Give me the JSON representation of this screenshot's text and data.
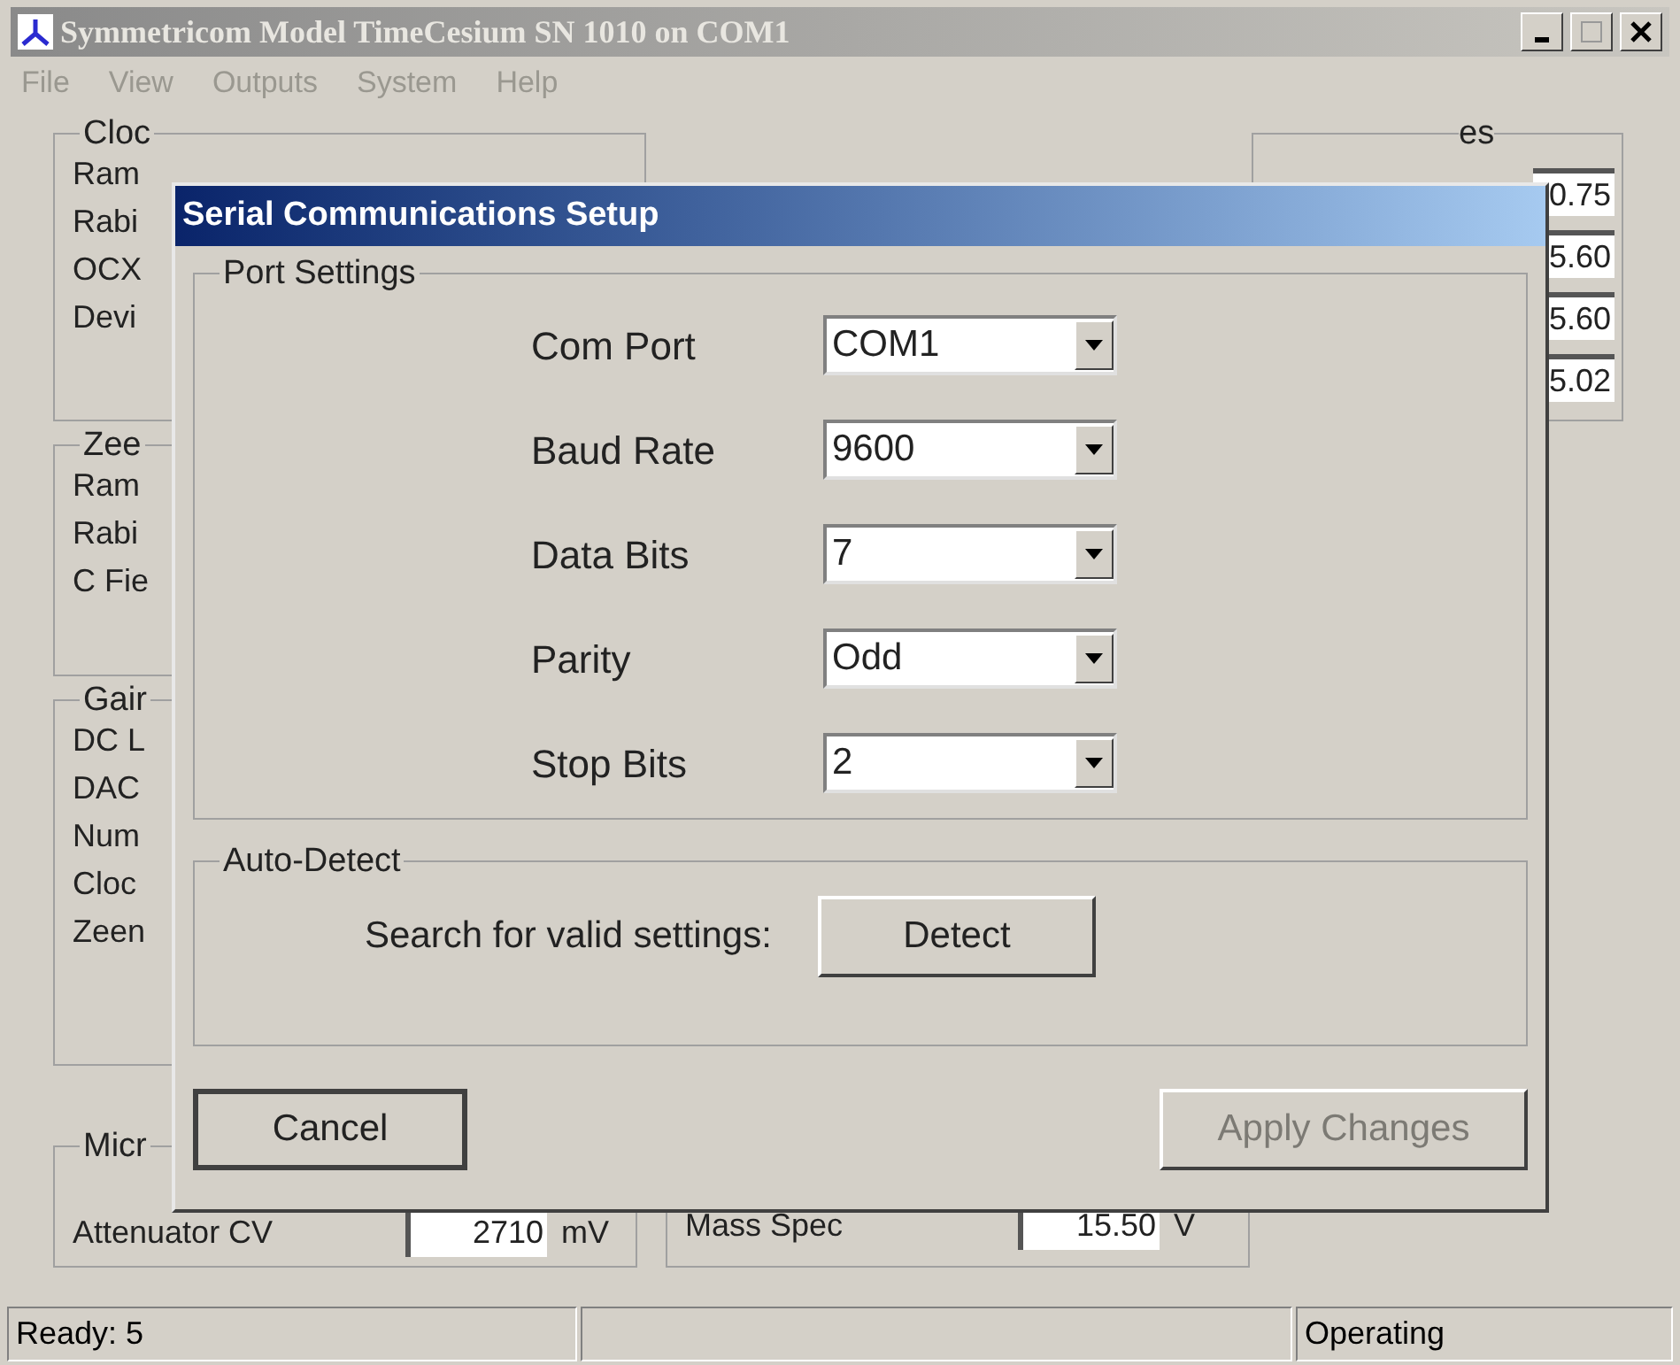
{
  "window": {
    "title": "Symmetricom Model TimeCesium SN 1010 on COM1"
  },
  "menu": [
    {
      "label": "File",
      "disabled": true
    },
    {
      "label": "View",
      "disabled": true
    },
    {
      "label": "Outputs",
      "disabled": true
    },
    {
      "label": "System",
      "disabled": true
    },
    {
      "label": "Help",
      "disabled": true
    }
  ],
  "left_groups": [
    {
      "label": "Cloc",
      "rows": [
        "Ram",
        "Rabi",
        "OCX",
        "Devi"
      ]
    },
    {
      "label": "Zee",
      "rows": [
        "Ram",
        "Rabi",
        "C Fie"
      ]
    },
    {
      "label": "Gair",
      "rows": [
        "DC L",
        "DAC",
        "Num",
        "Cloc",
        "Zeen"
      ]
    }
  ],
  "bottom_groups": [
    {
      "label": "Micr",
      "label_visible": true,
      "rows": [
        {
          "label": "Attenuator CV",
          "value": "2710",
          "unit": "mV"
        }
      ]
    },
    {
      "rows": [
        {
          "label": "Mass Spec",
          "value": "15.50",
          "unit": "V"
        }
      ]
    }
  ],
  "right_group": {
    "label": "es",
    "values": [
      "0.75",
      "5.60",
      "5.60",
      "5.02"
    ]
  },
  "dialog": {
    "title": "Serial Communications Setup",
    "port_settings": {
      "label": "Port Settings",
      "fields": [
        {
          "label": "Com Port",
          "value": "COM1"
        },
        {
          "label": "Baud Rate",
          "value": "9600"
        },
        {
          "label": "Data Bits",
          "value": "7"
        },
        {
          "label": "Parity",
          "value": "Odd"
        },
        {
          "label": "Stop Bits",
          "value": "2"
        }
      ]
    },
    "auto_detect": {
      "label": "Auto-Detect",
      "text": "Search for valid settings:",
      "button": "Detect"
    },
    "buttons": [
      {
        "label": "Cancel",
        "default": true,
        "disabled": false
      },
      {
        "label": "Apply Changes",
        "default": false,
        "disabled": true
      }
    ]
  },
  "status_bar": {
    "left": "Ready: 5",
    "right": "Operating"
  }
}
